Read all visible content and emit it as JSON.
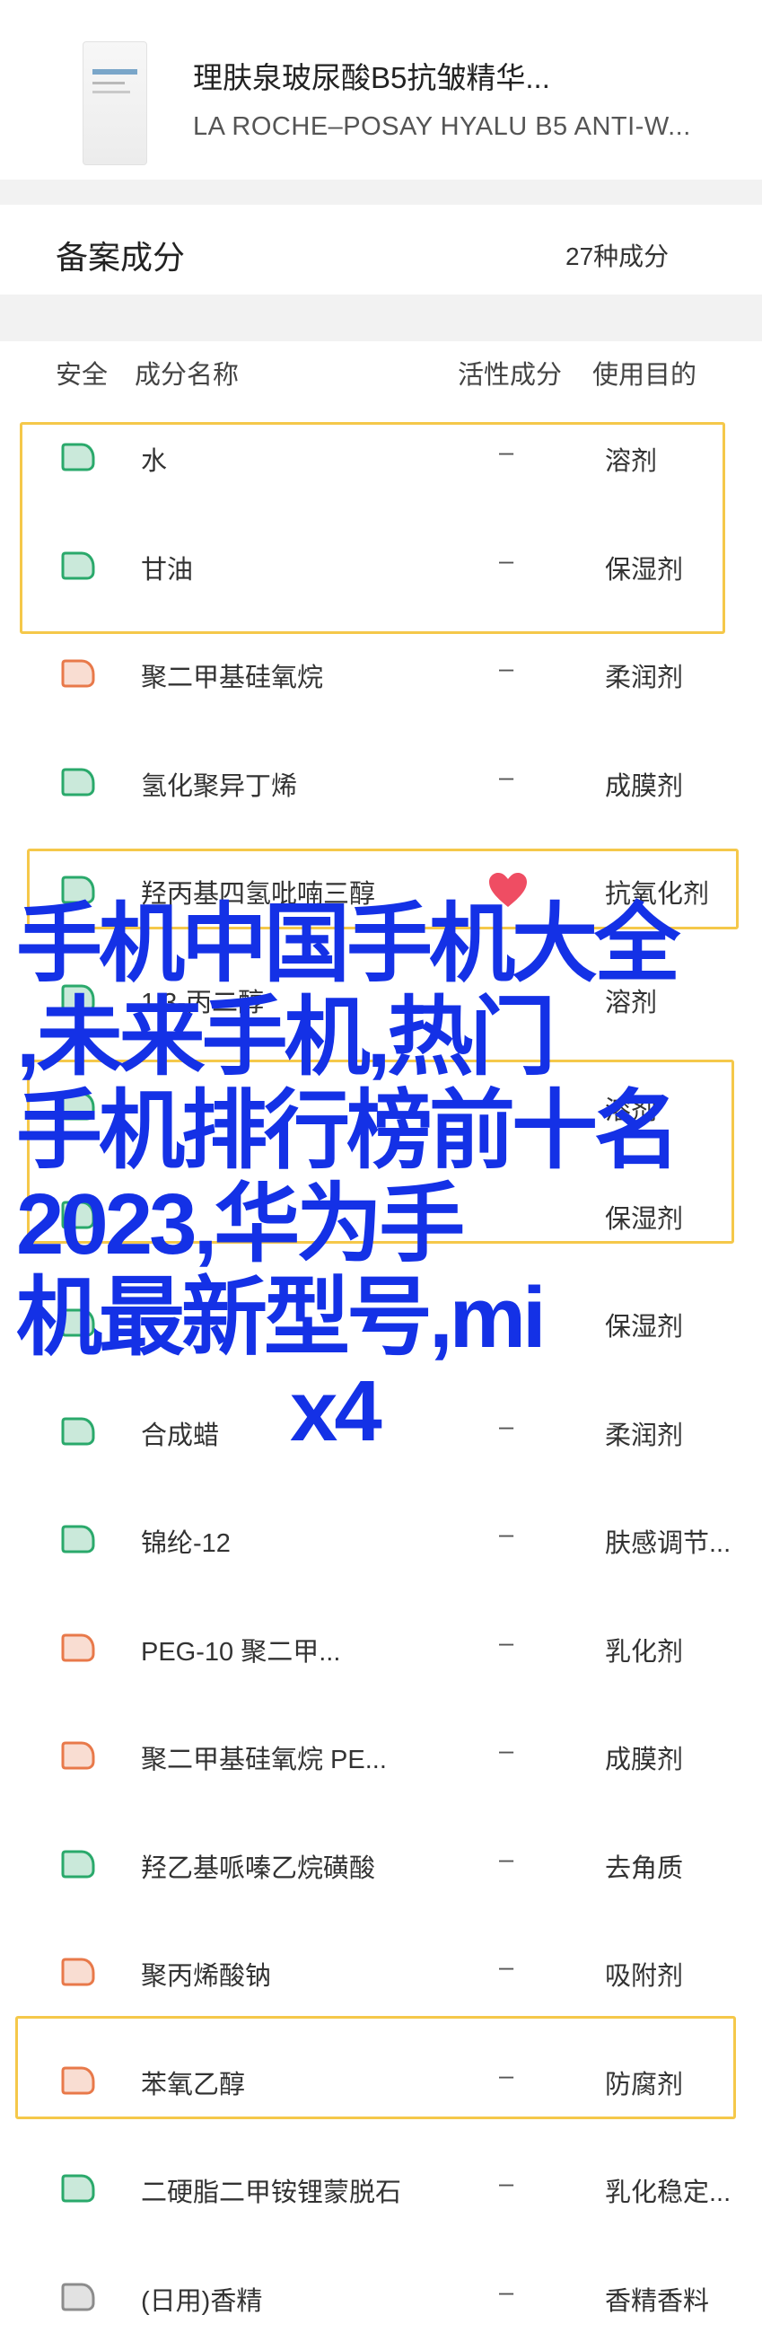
{
  "product": {
    "title": "理肤泉玻尿酸B5抗皱精华...",
    "subtitle": "LA ROCHE–POSAY HYALU B5 ANTI-W..."
  },
  "section": {
    "title": "备案成分",
    "count": "27种成分"
  },
  "table_head": {
    "safety": "安全",
    "name": "成分名称",
    "activity": "活性成分",
    "purpose": "使用目的"
  },
  "rows": [
    {
      "name": "水",
      "activity": "–",
      "purpose": "溶剂",
      "safety": "green"
    },
    {
      "name": "甘油",
      "activity": "–",
      "purpose": "保湿剂",
      "safety": "green"
    },
    {
      "name": "聚二甲基硅氧烷",
      "activity": "–",
      "purpose": "柔润剂",
      "safety": "orange"
    },
    {
      "name": "氢化聚异丁烯",
      "activity": "–",
      "purpose": "成膜剂",
      "safety": "green"
    },
    {
      "name": "羟丙基四氢吡喃三醇",
      "activity": "",
      "purpose": "抗氧化剂",
      "safety": "green"
    },
    {
      "name": "1,3-丙二醇",
      "activity": "",
      "purpose": "溶剂",
      "safety": "green"
    },
    {
      "name": "",
      "activity": "",
      "purpose": "溶剂",
      "safety": "green"
    },
    {
      "name": "",
      "activity": "",
      "purpose": "保湿剂",
      "safety": "green"
    },
    {
      "name": "",
      "activity": "",
      "purpose": "保湿剂",
      "safety": "green"
    },
    {
      "name": "合成蜡",
      "activity": "–",
      "purpose": "柔润剂",
      "safety": "green"
    },
    {
      "name": "锦纶-12",
      "activity": "–",
      "purpose": "肤感调节...",
      "safety": "green"
    },
    {
      "name": "PEG-10 聚二甲...",
      "activity": "–",
      "purpose": "乳化剂",
      "safety": "orange"
    },
    {
      "name": "聚二甲基硅氧烷 PE...",
      "activity": "–",
      "purpose": "成膜剂",
      "safety": "orange"
    },
    {
      "name": "羟乙基哌嗪乙烷磺酸",
      "activity": "–",
      "purpose": "去角质",
      "safety": "green"
    },
    {
      "name": "聚丙烯酸钠",
      "activity": "–",
      "purpose": "吸附剂",
      "safety": "orange"
    },
    {
      "name": "苯氧乙醇",
      "activity": "–",
      "purpose": "防腐剂",
      "safety": "orange"
    },
    {
      "name": "二硬脂二甲铵锂蒙脱石",
      "activity": "–",
      "purpose": "乳化稳定...",
      "safety": "green"
    },
    {
      "name": "(日用)香精",
      "activity": "–",
      "purpose": "香精香料",
      "safety": "gray"
    }
  ],
  "overlay_lines": [
    "手机中国手机大全",
    ",未来手机,热门",
    "手机排行榜前十名",
    "2023,华为手",
    "机最新型号,mi",
    "x4"
  ],
  "colors": {
    "green": "#2aa96b",
    "orange": "#e8794a",
    "gray": "#8c8c8c",
    "highlight": "#f5c84a",
    "overlay": "#1431e6",
    "heart": "#ef4d63"
  }
}
